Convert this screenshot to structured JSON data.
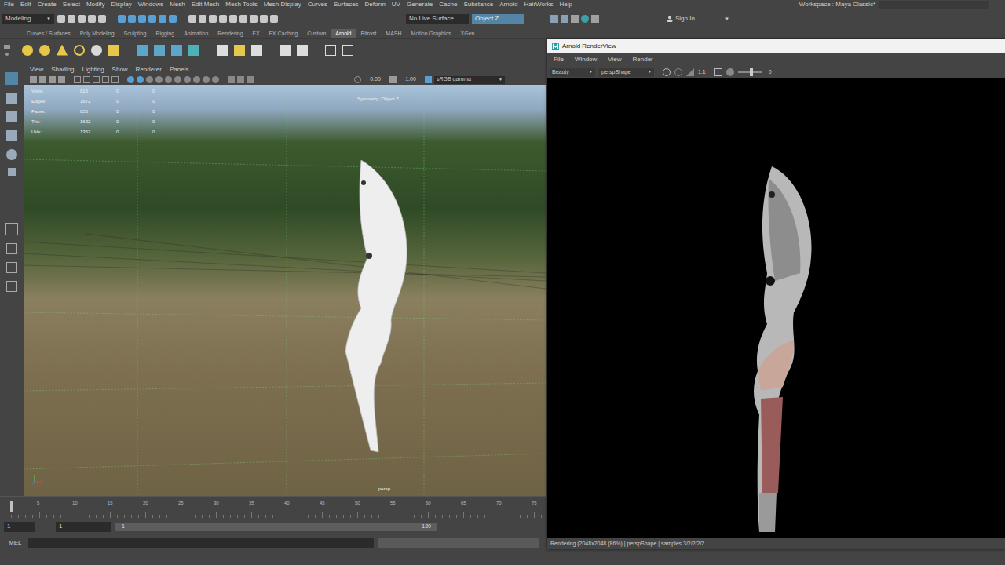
{
  "menubar": {
    "items": [
      "File",
      "Edit",
      "Create",
      "Select",
      "Modify",
      "Display",
      "Windows",
      "Mesh",
      "Edit Mesh",
      "Mesh Tools",
      "Mesh Display",
      "Curves",
      "Surfaces",
      "Deform",
      "UV",
      "Generate",
      "Cache",
      "Substance",
      "Arnold",
      "HairWorks",
      "Help"
    ],
    "workspace": "Workspace : Maya Classic*"
  },
  "statusline": {
    "mode": "Modeling",
    "live_surface": "No Live Surface",
    "symmetry_field": "Object Z",
    "sign_in": "Sign In"
  },
  "shelf": {
    "tabs": [
      {
        "label": "Curves / Surfaces",
        "selected": false
      },
      {
        "label": "Poly Modeling",
        "selected": false
      },
      {
        "label": "Sculpting",
        "selected": false
      },
      {
        "label": "Rigging",
        "selected": false
      },
      {
        "label": "Animation",
        "selected": false
      },
      {
        "label": "Rendering",
        "selected": false
      },
      {
        "label": "FX",
        "selected": false
      },
      {
        "label": "FX Caching",
        "selected": false
      },
      {
        "label": "Custom",
        "selected": false
      },
      {
        "label": "Arnold",
        "selected": true
      },
      {
        "label": "Bifrost",
        "selected": false
      },
      {
        "label": "MASH",
        "selected": false
      },
      {
        "label": "Motion Graphics",
        "selected": false
      },
      {
        "label": "XGen",
        "selected": false
      }
    ]
  },
  "viewport": {
    "menu": [
      "View",
      "Shading",
      "Lighting",
      "Show",
      "Renderer",
      "Panels"
    ],
    "toolbar": {
      "exposure": "0.00",
      "gamma": "1.00",
      "color_space": "sRGB gamma"
    },
    "hud": [
      {
        "label": "Verts:",
        "values": [
          "816",
          "0",
          "0"
        ]
      },
      {
        "label": "Edges:",
        "values": [
          "1672",
          "0",
          "0"
        ]
      },
      {
        "label": "Faces:",
        "values": [
          "856",
          "0",
          "0"
        ]
      },
      {
        "label": "Tris:",
        "values": [
          "1632",
          "0",
          "0"
        ]
      },
      {
        "label": "UVs:",
        "values": [
          "1362",
          "0",
          "0"
        ]
      }
    ],
    "symmetry": "Symmetry: Object Z",
    "camera": "persp"
  },
  "render_view": {
    "title": "Arnold RenderView",
    "menu": [
      "File",
      "Window",
      "View",
      "Render"
    ],
    "aov": "Beauty",
    "camera": "perspShape",
    "zoom": "1:1",
    "exposure": "0",
    "exposure_level": 0.5,
    "status": "Rendering (2048x2048 (86%) | perspShape | samples 3/2/2/2/2"
  },
  "timeline": {
    "ticks": [
      "5",
      "10",
      "15",
      "20",
      "25",
      "30",
      "35",
      "40",
      "45",
      "50",
      "55",
      "60",
      "65",
      "70",
      "75"
    ]
  },
  "range": {
    "start": "1",
    "playback_start": "1",
    "slider_start": "1",
    "slider_end": "120"
  },
  "command_line": {
    "language": "MEL"
  }
}
